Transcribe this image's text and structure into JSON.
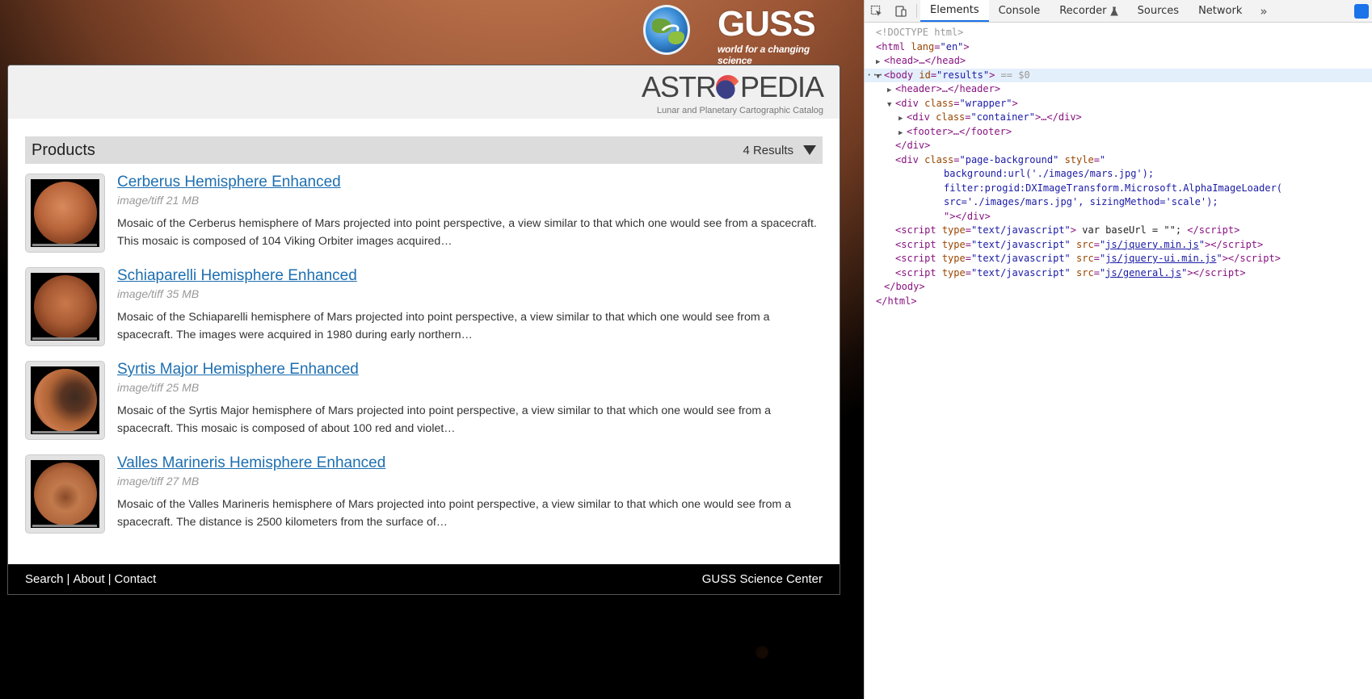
{
  "page": {
    "logos": {
      "guss_mark": "GUSS",
      "guss_tagline": "world for a changing science",
      "site_name_left": "ASTR",
      "site_name_right": "PEDIA",
      "site_subtitle": "Lunar and Planetary Cartographic Catalog"
    },
    "products": {
      "title": "Products",
      "count": "4 Results",
      "items": [
        {
          "title": "Cerberus Hemisphere Enhanced",
          "meta": "image/tiff 21 MB",
          "desc": "Mosaic of the Cerberus hemisphere of Mars projected into point perspective, a view similar to that which one would see from a spacecraft. This mosaic is composed of 104 Viking Orbiter images acquired…"
        },
        {
          "title": "Schiaparelli Hemisphere Enhanced",
          "meta": "image/tiff 35 MB",
          "desc": "Mosaic of the Schiaparelli hemisphere of Mars projected into point perspective, a view similar to that which one would see from a spacecraft. The images were acquired in 1980 during early northern…"
        },
        {
          "title": "Syrtis Major Hemisphere Enhanced",
          "meta": "image/tiff 25 MB",
          "desc": "Mosaic of the Syrtis Major hemisphere of Mars projected into point perspective, a view similar to that which one would see from a spacecraft. This mosaic is composed of about 100 red and violet…"
        },
        {
          "title": "Valles Marineris Hemisphere Enhanced",
          "meta": "image/tiff 27 MB",
          "desc": "Mosaic of the Valles Marineris hemisphere of Mars projected into point perspective, a view similar to that which one would see from a spacecraft. The distance is 2500 kilometers from the surface of…"
        }
      ]
    },
    "footer": {
      "search": "Search",
      "about": "About",
      "contact": "Contact",
      "separator": "|",
      "center": "GUSS Science Center"
    }
  },
  "devtools": {
    "tabs": [
      "Elements",
      "Console",
      "Recorder",
      "Sources",
      "Network"
    ],
    "active_tab": "Elements",
    "more": "»",
    "selected_suffix": "== $0",
    "lines": {
      "doctype": "<!DOCTYPE html>",
      "html_open_tag": "<html",
      "html_attr": "lang",
      "html_val": "\"en\"",
      "head": "<head>…</head>",
      "body_tag": "<body",
      "body_attr": "id",
      "body_val": "\"results\"",
      "header": "<header>…</header>",
      "wrapper_tag": "<div",
      "wrapper_attr": "class",
      "wrapper_val": "\"wrapper\"",
      "container_tag": "<div",
      "container_attr": "class",
      "container_val": "\"container\"",
      "container_rest": ">…</div>",
      "footer": "<footer>…</footer>",
      "div_close": "</div>",
      "bg_tag": "<div",
      "bg_attr1": "class",
      "bg_val1": "\"page-background\"",
      "bg_attr2": "style",
      "bg_style1": "background:url('./images/mars.jpg');",
      "bg_style2": "filter:progid:DXImageTransform.Microsoft.AlphaImageLoader(",
      "bg_style3": "src='./images/mars.jpg', sizingMethod='scale');",
      "bg_style_end": "\"></div>",
      "script_inline_text": " var baseUrl = \"\"; ",
      "script_src_1": "js/jquery.min.js",
      "script_src_2": "js/jquery-ui.min.js",
      "script_src_3": "js/general.js",
      "body_close": "</body>",
      "html_close": "</html>"
    }
  },
  "colors": {
    "link": "#1d6fb1",
    "devtools_accent": "#1a73e8",
    "selected_row": "#e4effc"
  }
}
